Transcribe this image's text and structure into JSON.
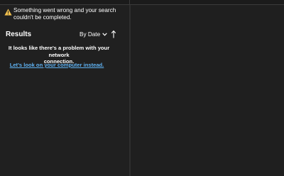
{
  "error": {
    "icon": "warning-icon",
    "line1": "Something went wrong and your search",
    "line2": "couldn't be completed."
  },
  "results": {
    "title": "Results",
    "sort_label": "By Date",
    "sort_icon": "chevron-down-icon",
    "direction_icon": "arrow-up-icon"
  },
  "message": {
    "line1": "It looks like there's a problem with your network",
    "line2": "connection."
  },
  "local_search_link": "Let's look on your computer instead.",
  "colors": {
    "background": "#202020",
    "warning": "#f2c14e",
    "link": "#5fb2f2"
  }
}
